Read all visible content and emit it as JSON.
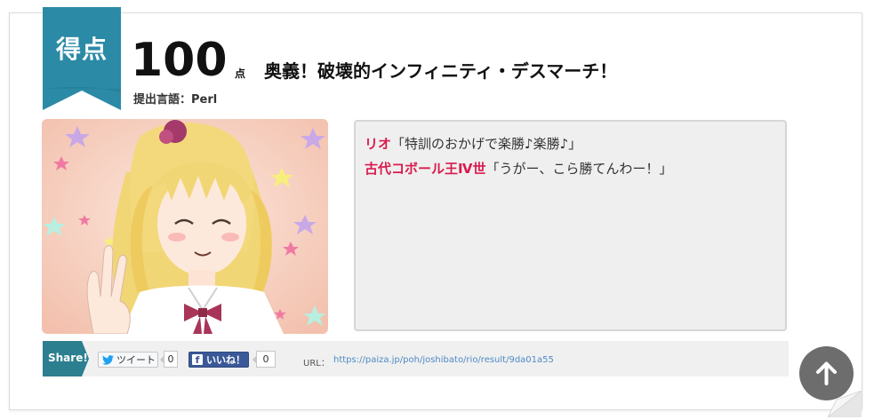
{
  "result": {
    "badge_label": "得点",
    "score": "100",
    "score_unit": "点",
    "title": "奥義！破壊的インフィニティ・デスマーチ！",
    "language": "提出言語：Perl"
  },
  "dialog": {
    "lines": [
      {
        "speaker": "リオ",
        "text": "「特訓のおかげで楽勝♪楽勝♪」"
      },
      {
        "speaker": "古代コボール王Ⅳ世",
        "text": "「うがー、こら勝てんわー！」"
      }
    ]
  },
  "share": {
    "label": "Share!",
    "tweet_label": "ツイート",
    "tweet_count": "0",
    "like_label": "いいね！",
    "like_count": "0",
    "url_label": "URL：",
    "url": "https://paiza.jp/poh/joshibato/rio/result/9da01a55"
  },
  "colors": {
    "ribbon": "#2b8aa6",
    "speaker": "#d81b4e",
    "link": "#4e8ac5",
    "facebook": "#3b5998"
  },
  "icons": [
    "twitter-bird-icon",
    "facebook-f-icon",
    "arrow-up-icon"
  ]
}
